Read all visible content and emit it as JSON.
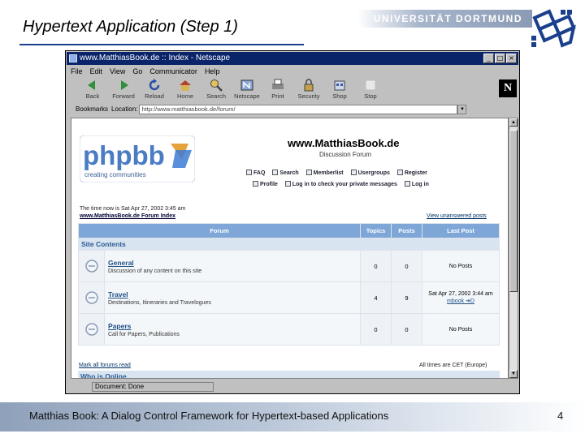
{
  "slide": {
    "title": "Hypertext Application (Step 1)",
    "university": "UNIVERSITÄT DORTMUND",
    "footer": "Matthias Book: A Dialog Control Framework for Hypertext-based Applications",
    "page_number": "4",
    "accent_color": "#1a3f8c"
  },
  "browser": {
    "title": "www.MatthiasBook.de :: Index - Netscape",
    "window_buttons": [
      "_",
      "□",
      "×"
    ],
    "menu": [
      "File",
      "Edit",
      "View",
      "Go",
      "Communicator",
      "Help"
    ],
    "toolbar": [
      {
        "label": "Back",
        "icon": "back-icon"
      },
      {
        "label": "Forward",
        "icon": "forward-icon"
      },
      {
        "label": "Reload",
        "icon": "reload-icon"
      },
      {
        "label": "Home",
        "icon": "home-icon"
      },
      {
        "label": "Search",
        "icon": "search-icon"
      },
      {
        "label": "Netscape",
        "icon": "netscape-icon"
      },
      {
        "label": "Print",
        "icon": "print-icon"
      },
      {
        "label": "Security",
        "icon": "security-icon"
      },
      {
        "label": "Shop",
        "icon": "shop-icon"
      },
      {
        "label": "Stop",
        "icon": "stop-icon"
      }
    ],
    "bookmarks_label": "Bookmarks",
    "location_label": "Location:",
    "location_value": "http://www.matthiasbook.de/forum/",
    "status": "Document: Done"
  },
  "forum": {
    "site_name": "www.MatthiasBook.de",
    "site_desc": "Discussion Forum",
    "logo_text": "phpbb",
    "logo_tagline": "creating communities",
    "links_row1": [
      "FAQ",
      "Search",
      "Memberlist",
      "Usergroups",
      "Register"
    ],
    "links_row2": [
      "Profile",
      "Log in to check your private messages",
      "Log in"
    ],
    "current_time": "The time now is Sat Apr 27, 2002 3:45 am",
    "index_link": "www.MatthiasBook.de Forum Index",
    "unanswered_link": "View unanswered posts",
    "headers": [
      "Forum",
      "Topics",
      "Posts",
      "Last Post"
    ],
    "category": "Site Contents",
    "rows": [
      {
        "name": "General",
        "desc": "Discussion of any content on this site",
        "topics": "0",
        "posts": "0",
        "last": "No Posts",
        "last_link": ""
      },
      {
        "name": "Travel",
        "desc": "Destinations, Itineraries and Travelogues",
        "topics": "4",
        "posts": "9",
        "last": "Sat Apr 27, 2002 3:44 am",
        "last_link": "mbook ➔D"
      },
      {
        "name": "Papers",
        "desc": "Call for Papers, Publications",
        "topics": "0",
        "posts": "0",
        "last": "No Posts",
        "last_link": ""
      }
    ],
    "mark_read": "Mark all forums read",
    "timezone": "All times are CET (Europe)",
    "who_online": "Who is Online",
    "header_color": "#7ea7d8",
    "category_color": "#d9e4f1"
  }
}
